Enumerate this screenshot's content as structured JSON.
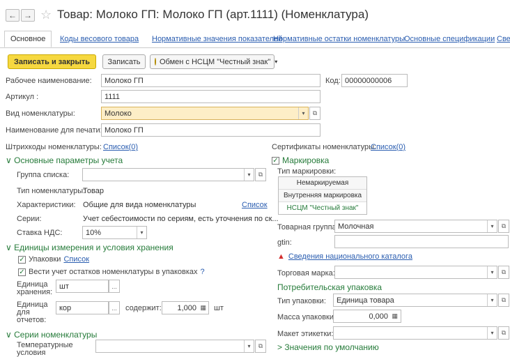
{
  "window": {
    "title": "Товар: Молоко ГП: Молоко ГП (арт.1111) (Номенклатура)",
    "back": "←",
    "forward": "→"
  },
  "tabs": [
    {
      "label": "Основное"
    },
    {
      "label": "Коды весового товара"
    },
    {
      "label": "Нормативные значения показателей"
    },
    {
      "label": "Нормативные остатки номенклатуры"
    },
    {
      "label": "Основные спецификации"
    },
    {
      "label": "Све"
    }
  ],
  "toolbar": {
    "save_close": "Записать и закрыть",
    "save": "Записать",
    "exchange": "Обмен с НСЦМ \"Честный знак\""
  },
  "form": {
    "work_name_label": "Рабочее наименование:",
    "work_name": "Молоко ГП",
    "code_label": "Код:",
    "code": "00000000006",
    "article_label": "Артикул :",
    "article": "1111",
    "kind_label": "Вид номенклатуры:",
    "kind": "Молоко",
    "print_name_label": "Наименование для печати:",
    "print_name": "Молоко ГП",
    "barcodes_label": "Штрихкоды номенклатуры:",
    "barcodes_link": "Список(0)",
    "certs_label": "Сертификаты номенклатуры:",
    "certs_link": "Список(0)"
  },
  "accounting": {
    "title": "Основные параметры учета",
    "group_label": "Группа списка:",
    "group": "",
    "type_label": "Тип номенклатуры:",
    "type": "Товар",
    "chars_label": "Характеристики:",
    "chars": "Общие для вида номенклатуры",
    "chars_link": "Список",
    "series_label": "Серии:",
    "series": "Учет себестоимости по сериям, есть уточнения по ск...",
    "vat_label": "Ставка НДС:",
    "vat": "10%"
  },
  "units": {
    "title": "Единицы измерения и условия хранения",
    "packs_label": "Упаковки",
    "packs_link": "Список",
    "track_label": "Вести учет остатков номенклатуры в упаковках",
    "help": "?",
    "storage_unit_label_1": "Единица",
    "storage_unit_label_2": "хранения:",
    "storage_unit": "шт",
    "report_unit_label_1": "Единица",
    "report_unit_label_2": "для",
    "report_unit_label_3": "отчетов:",
    "report_unit": "кор",
    "contains_label": "содержит:",
    "contains": "1,000",
    "contains_unit": "шт",
    "ellipsis": "..."
  },
  "series_section": {
    "title": "Серии номенклатуры",
    "temp_label_1": "Температурные",
    "temp_label_2": "условия"
  },
  "marking": {
    "title": "Маркировка",
    "type_label": "Тип маркировки:",
    "options": [
      "Немаркируемая",
      "Внутренняя маркировка",
      "НСЦМ \"Честный знак\""
    ],
    "product_group_label": "Товарная группа:",
    "product_group": "Молочная",
    "gtin_label": "gtin:",
    "gtin": "",
    "catalog_link": "Сведения национального каталога",
    "brand_label": "Торговая марка:",
    "brand": ""
  },
  "consumer_pack": {
    "title": "Потребительская упаковка",
    "pack_type_label": "Тип упаковки:",
    "pack_type": "Единица товара",
    "mass_label": "Масса упаковки:",
    "mass": "0,000",
    "layout_label": "Макет этикетки:",
    "layout": ""
  },
  "defaults": {
    "title": "Значения по умолчанию"
  },
  "colors": {
    "accent_green": "#267b3a",
    "link_blue": "#2a5db0",
    "primary_yellow": "#f6d840",
    "warning_red": "#d32f2f"
  }
}
